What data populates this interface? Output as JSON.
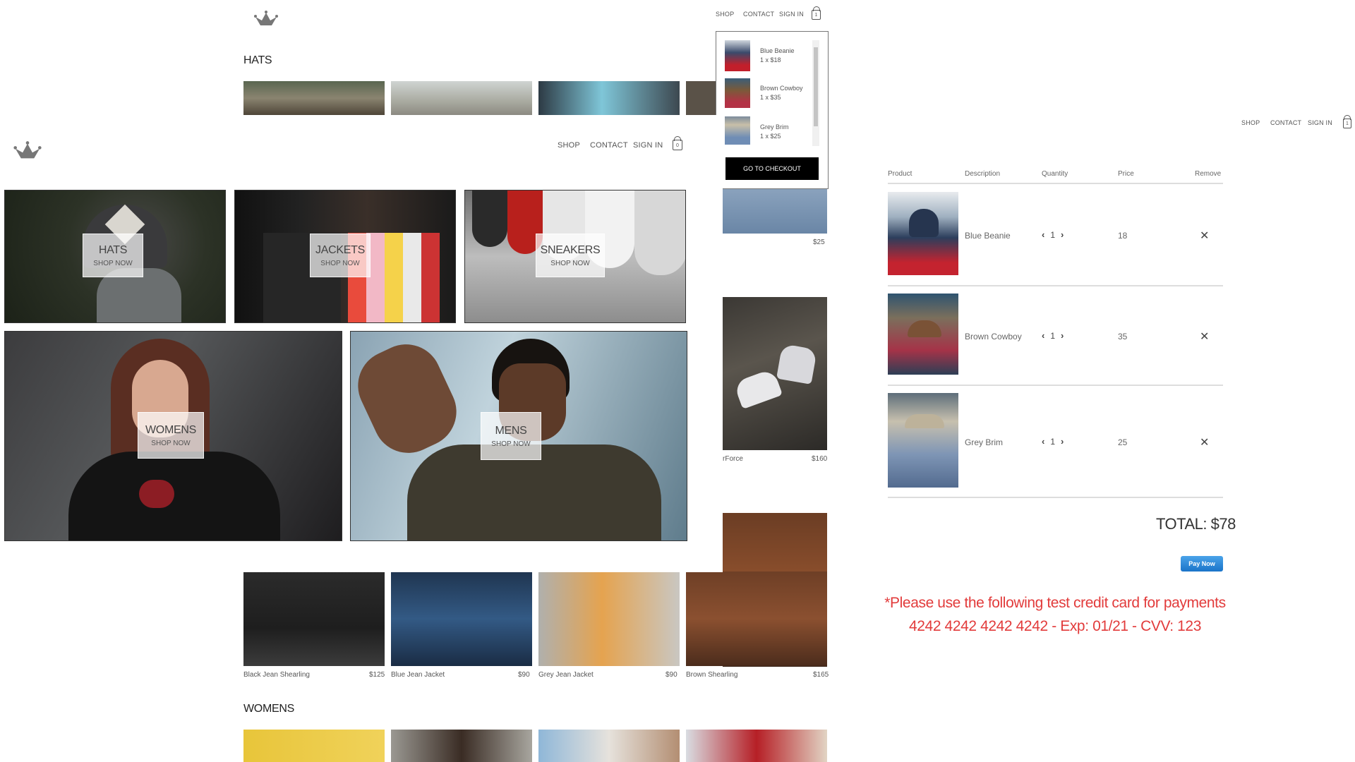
{
  "nav": {
    "shop": "SHOP",
    "contact": "CONTACT",
    "sign_in": "SIGN IN",
    "cart_count": "1"
  },
  "nav_main": {
    "cart_count": "0"
  },
  "hats_section": {
    "title": "HATS"
  },
  "directory": [
    {
      "title": "HATS",
      "subtitle": "SHOP NOW"
    },
    {
      "title": "JACKETS",
      "subtitle": "SHOP NOW"
    },
    {
      "title": "SNEAKERS",
      "subtitle": "SHOP NOW"
    },
    {
      "title": "WOMENS",
      "subtitle": "SHOP NOW"
    },
    {
      "title": "MENS",
      "subtitle": "SHOP NOW"
    }
  ],
  "cart_dropdown": {
    "items": [
      {
        "name": "Blue Beanie",
        "qty": "1 x $18"
      },
      {
        "name": "Brown Cowboy",
        "qty": "1 x $35"
      },
      {
        "name": "Grey Brim",
        "qty": "1 x $25"
      }
    ],
    "checkout_label": "GO TO CHECKOUT"
  },
  "side_products": [
    {
      "name": "",
      "price": "$25"
    },
    {
      "name": "rForce",
      "price": "$160"
    }
  ],
  "jackets_row": [
    {
      "name": "Black Jean Shearling",
      "price": "$125"
    },
    {
      "name": "Blue Jean Jacket",
      "price": "$90"
    },
    {
      "name": "Grey Jean Jacket",
      "price": "$90"
    },
    {
      "name": "Brown Shearling",
      "price": "$165"
    }
  ],
  "womens_section": {
    "title": "WOMENS"
  },
  "checkout": {
    "headers": {
      "product": "Product",
      "description": "Description",
      "quantity": "Quantity",
      "price": "Price",
      "remove": "Remove"
    },
    "items": [
      {
        "description": "Blue Beanie",
        "quantity": "1",
        "price": "18"
      },
      {
        "description": "Brown Cowboy",
        "quantity": "1",
        "price": "35"
      },
      {
        "description": "Grey Brim",
        "quantity": "1",
        "price": "25"
      }
    ],
    "total": "TOTAL: $78",
    "pay_label": "Pay Now",
    "note_line1": "*Please use the following test credit card for payments",
    "note_line2": "4242 4242 4242 4242 - Exp: 01/21 - CVV: 123"
  },
  "colors": {
    "note_red": "#e23b3b",
    "pay_blue": "#1a74c9",
    "checkout_black": "#000000"
  }
}
